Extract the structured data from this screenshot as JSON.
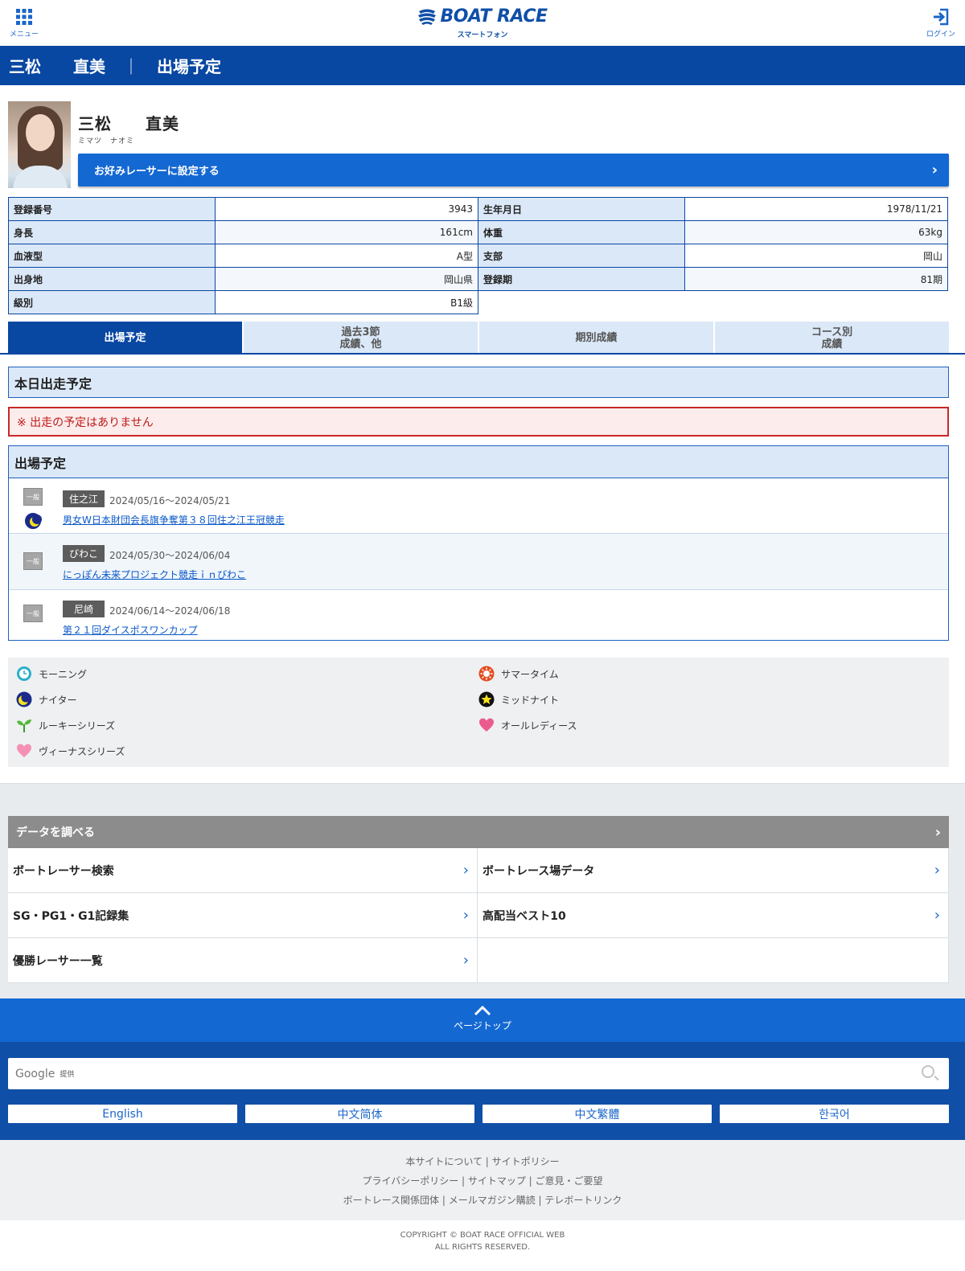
{
  "header": {
    "menu_label": "メニュー",
    "logo_text": "BOAT RACE",
    "logo_sub": "スマートフォン",
    "login_label": "ログイン",
    "accent": "#0847a2"
  },
  "title_bar": {
    "name": "三松　　直美",
    "separator": "｜",
    "page": "出場予定"
  },
  "profile": {
    "name": "三松　　直美",
    "kana": "ミマツ　ナオミ",
    "favorite_button": "お好みレーサーに設定する"
  },
  "info": {
    "reg_no_label": "登録番号",
    "reg_no": "3943",
    "birth_label": "生年月日",
    "birth": "1978/11/21",
    "height_label": "身長",
    "height": "161cm",
    "weight_label": "体重",
    "weight": "63kg",
    "blood_label": "血液型",
    "blood": "A型",
    "branch_label": "支部",
    "branch": "岡山",
    "origin_label": "出身地",
    "origin": "岡山県",
    "term_label": "登録期",
    "term": "81期",
    "class_label": "級別",
    "class": "B1級"
  },
  "tabs": [
    {
      "label": "出場予定"
    },
    {
      "label_line1": "過去3節",
      "label_line2": "成績、他"
    },
    {
      "label": "期別成績"
    },
    {
      "label_line1": "コース別",
      "label_line2": "成績"
    }
  ],
  "today": {
    "heading": "本日出走予定",
    "notice": "※ 出走の予定はありません"
  },
  "schedule": {
    "heading": "出場予定",
    "items": [
      {
        "grade": "一般",
        "venue": "住之江",
        "dates": "2024/05/16〜2024/05/21",
        "title": "男女W日本財団会長旗争奪第３８回住之江王冠競走",
        "icon": "nighter-moon-icon"
      },
      {
        "grade": "一般",
        "venue": "びわこ",
        "dates": "2024/05/30〜2024/06/04",
        "title": "にっぽん未来プロジェクト競走ｉｎびわこ"
      },
      {
        "grade": "一般",
        "venue": "尼崎",
        "dates": "2024/06/14〜2024/06/18",
        "title": "第２１回ダイスポスワンカップ"
      }
    ]
  },
  "legend": [
    {
      "label": "モーニング",
      "icon": "morning-clock-icon"
    },
    {
      "label": "サマータイム",
      "icon": "summer-sun-icon"
    },
    {
      "label": "ナイター",
      "icon": "nighter-moon-icon"
    },
    {
      "label": "ミッドナイト",
      "icon": "midnight-star-icon"
    },
    {
      "label": "ルーキーシリーズ",
      "icon": "rookie-sprout-icon"
    },
    {
      "label": "オールレディース",
      "icon": "all-ladies-heart-icon"
    },
    {
      "label": "ヴィーナスシリーズ",
      "icon": "venus-heart-icon"
    }
  ],
  "data_section": {
    "heading": "データを調べる",
    "links": [
      "ボートレーサー検索",
      "ボートレース場データ",
      "SG・PG1・G1記録集",
      "高配当ベスト10",
      "優勝レーサー一覧"
    ]
  },
  "page_top": "ページトップ",
  "search": {
    "provider": "Google",
    "provider_suffix": "提供"
  },
  "languages": [
    "English",
    "中文简体",
    "中文繁體",
    "한국어"
  ],
  "footer_links": {
    "line1": "本サイトについて | サイトポリシー",
    "line2": "プライバシーポリシー | サイトマップ | ご意見・ご要望",
    "line3": "ボートレース関係団体 | メールマガジン購読 | テレボートリンク"
  },
  "copyright": {
    "line1": "COPYRIGHT © BOAT RACE OFFICIAL WEB",
    "line2": "ALL RIGHTS RESERVED."
  }
}
